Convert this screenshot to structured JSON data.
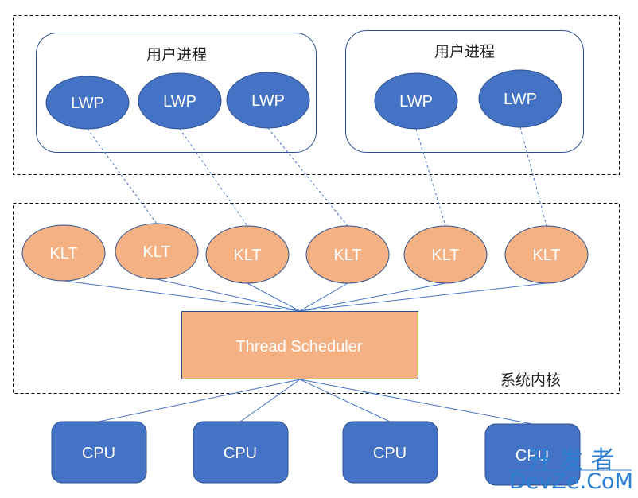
{
  "diagram": {
    "colors": {
      "lwp_fill": "#4472c4",
      "lwp_stroke": "#2f528f",
      "klt_fill": "#f4b183",
      "klt_stroke": "#2f528f",
      "scheduler_fill": "#f4b183",
      "cpu_fill": "#4472c4",
      "connector": "#4472c4",
      "dashed_border": "#000000",
      "process_border": "#2f528f",
      "watermark": "#2b7fd0"
    },
    "user_space": {
      "processes": [
        {
          "title": "用户进程",
          "lwps": [
            "LWP",
            "LWP",
            "LWP"
          ]
        },
        {
          "title": "用户进程",
          "lwps": [
            "LWP",
            "LWP"
          ]
        }
      ]
    },
    "kernel": {
      "label": "系统内核",
      "klts": [
        "KLT",
        "KLT",
        "KLT",
        "KLT",
        "KLT",
        "KLT"
      ],
      "scheduler": "Thread Scheduler"
    },
    "cpus": [
      "CPU",
      "CPU",
      "CPU",
      "CPU"
    ],
    "edges": {
      "lwp_to_klt": [
        [
          0,
          1
        ],
        [
          1,
          2
        ],
        [
          2,
          3
        ],
        [
          3,
          4
        ],
        [
          4,
          5
        ]
      ],
      "klt_to_scheduler": "all",
      "scheduler_to_cpu": "all"
    },
    "watermark": {
      "line1": "开 发 者",
      "line2": "DevZe.CoM"
    }
  }
}
